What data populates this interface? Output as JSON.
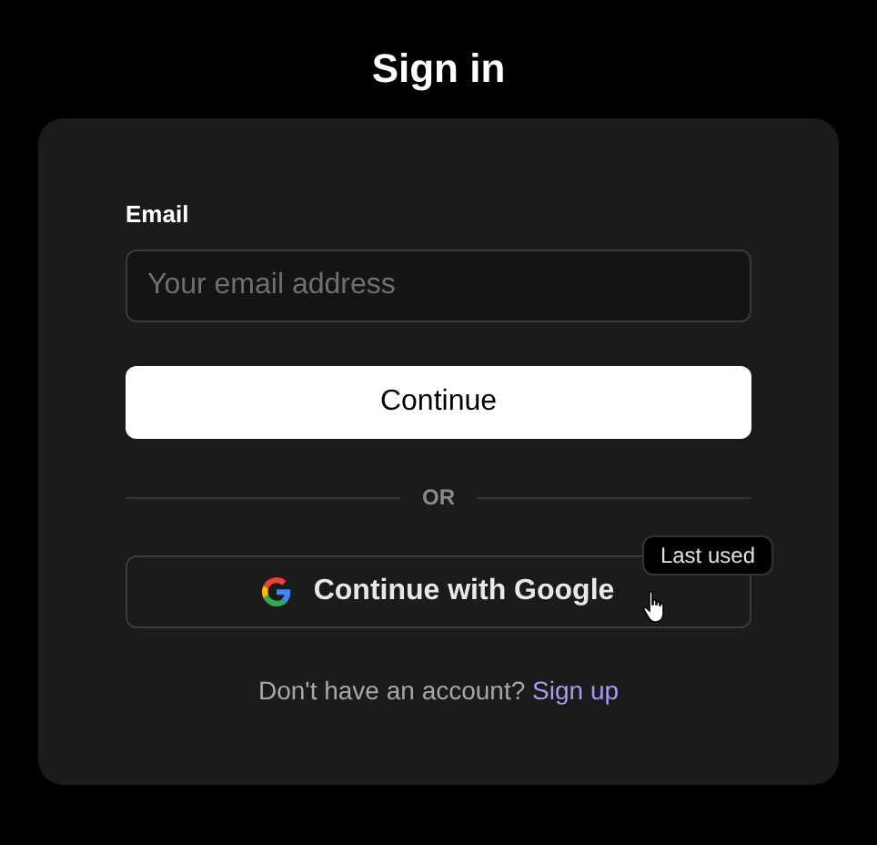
{
  "title": "Sign in",
  "email": {
    "label": "Email",
    "placeholder": "Your email address"
  },
  "continue_button": "Continue",
  "divider": "OR",
  "google_button": {
    "label": "Continue with Google",
    "badge": "Last used"
  },
  "footer": {
    "text": "Don't have an account?",
    "link": "Sign up"
  }
}
